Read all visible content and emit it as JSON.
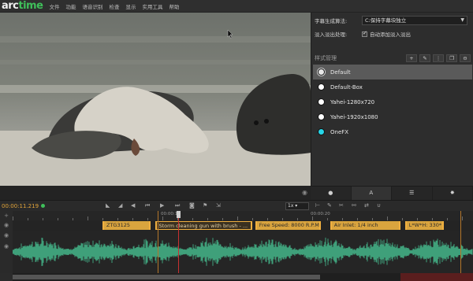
{
  "app": {
    "logo_part1": "arc",
    "logo_part2": "time",
    "menu": [
      "文件",
      "功能",
      "语音识别",
      "检查",
      "显示",
      "实用工具",
      "帮助"
    ]
  },
  "video": {
    "eye_icon": "eye-icon"
  },
  "right_panel": {
    "algo_label": "字幕生成算法:",
    "algo_value": "C:保持字幕块独立",
    "fade_label": "淡入淡出处理:",
    "fade_checkbox_label": "自动添加淡入淡出",
    "fade_checked": true,
    "style_title": "样式管理",
    "styles": [
      {
        "name": "Default",
        "color": "#e8e8e8",
        "selected": true
      },
      {
        "name": "Default-Box",
        "color": "#ffffff",
        "selected": false
      },
      {
        "name": "Yahei-1280x720",
        "color": "#ffffff",
        "selected": false
      },
      {
        "name": "Yahei-1920x1080",
        "color": "#ffffff",
        "selected": false
      },
      {
        "name": "OneFX",
        "color": "#27d6e8",
        "selected": false
      }
    ],
    "tabs": [
      "speech-bubble-icon",
      "text-a-icon",
      "list-icon",
      "gear-icon"
    ],
    "tab_glyphs": [
      "●",
      "A",
      "☰",
      "✸"
    ]
  },
  "timeline": {
    "timecode": "00:00:11.219",
    "speed": "1x",
    "ruler_labels": [
      {
        "text": "00:00:10",
        "value": 10
      },
      {
        "text": "00:00:20",
        "value": 20
      }
    ],
    "subtitles": [
      {
        "text": "ZTG3125",
        "start": 6.0,
        "end": 9.2,
        "current": false
      },
      {
        "text": "Storm cleaning gun with brush - ...",
        "start": 9.5,
        "end": 16.0,
        "current": true
      },
      {
        "text": "Free Speed: 8000 R.P.M.",
        "start": 16.2,
        "end": 20.6,
        "current": false
      },
      {
        "text": "Air Inlet: 1/4 inch",
        "start": 21.2,
        "end": 25.9,
        "current": false
      },
      {
        "text": "L*W*H: 330*",
        "start": 26.2,
        "end": 28.8,
        "current": false
      }
    ],
    "colors": {
      "subtitle_block": "#d9a43e",
      "waveform": "#3fa07a",
      "playhead": "#c83030",
      "timecode": "#e2a43a"
    }
  }
}
